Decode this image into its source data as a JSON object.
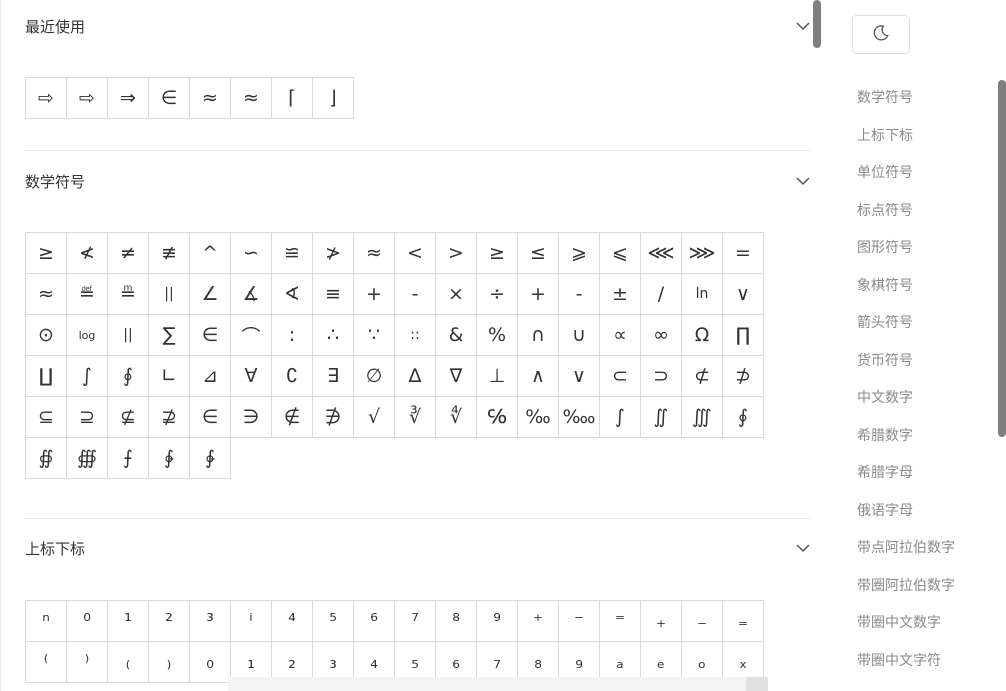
{
  "sections": {
    "recent": {
      "title": "最近使用",
      "symbols": [
        "⇨",
        "⇨",
        "⇒",
        "∈",
        "≈",
        "≈",
        "⌈",
        "⌋"
      ]
    },
    "math": {
      "title": "数学符号",
      "symbols": [
        "≥",
        "≮",
        "≠",
        "≢",
        "^",
        "∽",
        "≌",
        "≯",
        "≈",
        "<",
        ">",
        "≥",
        "≤",
        "⩾",
        "⩽",
        "⋘",
        "⋙",
        "=",
        "≈",
        "≝",
        "≞",
        "||",
        "∠",
        "∡",
        "∢",
        "≡",
        "+",
        "-",
        "×",
        "÷",
        "+",
        "-",
        "±",
        "/",
        "ln",
        "∨",
        "⊙",
        "log",
        "||",
        "∑",
        "∈",
        "⌒",
        ":",
        "∴",
        "∵",
        "::",
        "&",
        "%",
        "∩",
        "∪",
        "∝",
        "∞",
        "Ω",
        "∏",
        "∐",
        "∫",
        "∮",
        "∟",
        "⊿",
        "∀",
        "∁",
        "∃",
        "∅",
        "∆",
        "∇",
        "⊥",
        "∧",
        "∨",
        "⊂",
        "⊃",
        "⊄",
        "⊅",
        "⊆",
        "⊇",
        "⊈",
        "⊉",
        "∈",
        "∋",
        "∉",
        "∌",
        "√",
        "∛",
        "∜",
        "℅",
        "‰",
        "‱",
        "∫",
        "∬",
        "∭",
        "∮",
        "∯",
        "∰",
        "⨍",
        "∲",
        "∳"
      ]
    },
    "supsub": {
      "title": "上标下标",
      "symbols": [
        "ⁿ",
        "⁰",
        "¹",
        "²",
        "³",
        "ⁱ",
        "⁴",
        "⁵",
        "⁶",
        "⁷",
        "⁸",
        "⁹",
        "⁺",
        "⁻",
        "⁼",
        "₊",
        "₋",
        "₌",
        "⁽",
        "⁾",
        "₍",
        "₎",
        "₀",
        "₁",
        "₂",
        "₃",
        "₄",
        "₅",
        "₆",
        "₇",
        "₈",
        "₉",
        "ₐ",
        "ₑ",
        "ₒ",
        "ₓ"
      ]
    }
  },
  "sidebar": {
    "theme_icon": "moon-icon",
    "items": [
      "数学符号",
      "上标下标",
      "单位符号",
      "标点符号",
      "图形符号",
      "象棋符号",
      "箭头符号",
      "货币符号",
      "中文数字",
      "希腊数字",
      "希腊字母",
      "俄语字母",
      "带点阿拉伯数字",
      "带圈阿拉伯数字",
      "带圈中文数字",
      "带圈中文字符"
    ]
  },
  "icons": {
    "collapse": "chevron-down-icon"
  },
  "colors": {
    "border": "#d9d9d9",
    "sidebar_text": "#8a8a8a",
    "scrollbar": "#7f7f7f"
  }
}
